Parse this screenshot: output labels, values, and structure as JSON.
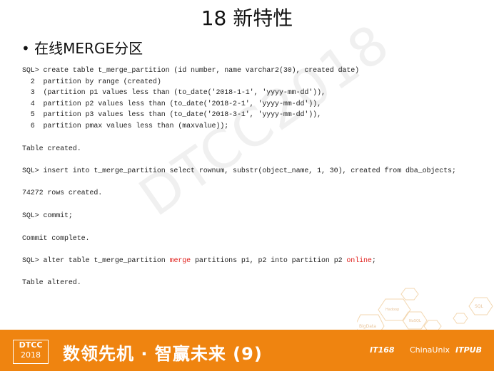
{
  "slide": {
    "title": "18 新特性",
    "bullet": "• 在线MERGE分区",
    "watermark": "DTCC2018",
    "code_lines": [
      "SQL> create table t_merge_partition (id number, name varchar2(30), created date)",
      "  2  partition by range (created)",
      "  3  (partition p1 values less than (to_date('2018-1-1', 'yyyy-mm-dd')),",
      "  4  partition p2 values less than (to_date('2018-2-1', 'yyyy-mm-dd')),",
      "  5  partition p3 values less than (to_date('2018-3-1', 'yyyy-mm-dd')),",
      "  6  partition pmax values less than (maxvalue));",
      "Table created.",
      "SQL> insert into t_merge_partition select rownum, substr(object_name, 1, 30), created from dba_objects;",
      "74272 rows created.",
      "SQL> commit;",
      "Commit complete.",
      "Table altered."
    ],
    "alter_line": {
      "prefix": "SQL> alter table t_merge_partition ",
      "kw1": "merge",
      "middle": " partitions p1, p2 into partition p2 ",
      "kw2": "online",
      "suffix": ";"
    },
    "highlight_color": "#e0201c"
  },
  "decoration": {
    "hex_labels": [
      "Hadoop",
      "SQL",
      "BigData",
      "NoSQL"
    ]
  },
  "footer": {
    "logo_top": "DTCC",
    "logo_year": "2018",
    "slogan": "数领先机 · 智赢未来 (9)",
    "sponsors": [
      "IT168",
      "ChinaUnix",
      "ITPUB"
    ],
    "color": "#ef8410"
  }
}
